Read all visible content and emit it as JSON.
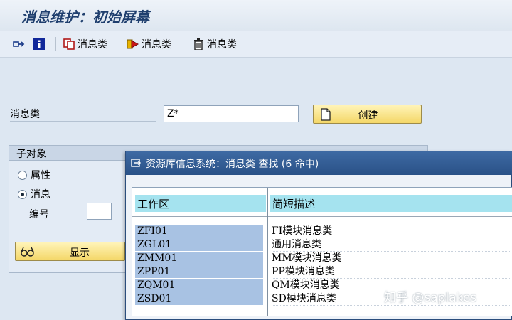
{
  "window": {
    "title": "消息维护：初始屏幕"
  },
  "toolbar": {
    "btn1_label": "消息类",
    "btn2_label": "消息类",
    "btn3_label": "消息类"
  },
  "form": {
    "message_class_label": "消息类",
    "message_class_value": "Z*",
    "create_label": "创建"
  },
  "subobject": {
    "title": "子对象",
    "attr_label": "属性",
    "msg_label": "消息",
    "number_label": "编号",
    "number_value": "",
    "selected": "消息",
    "show_label": "显示"
  },
  "popup": {
    "title": "资源库信息系统：消息类 查找 (6 命中)",
    "columns": [
      "工作区",
      "简短描述"
    ],
    "rows": [
      [
        "ZFI01",
        "FI模块消息类"
      ],
      [
        "ZGL01",
        "通用消息类"
      ],
      [
        "ZMM01",
        "MM模块消息类"
      ],
      [
        "ZPP01",
        "PP模块消息类"
      ],
      [
        "ZQM01",
        "QM模块消息类"
      ],
      [
        "ZSD01",
        "SD模块消息类"
      ]
    ]
  },
  "watermark": "知乎 @saplakes",
  "colors": {
    "title": "#1f3f6e",
    "popup_title_bar": "#2a5187",
    "column_header": "#a5e3ef",
    "key_cell": "#a8c2e3",
    "button_yellow": "#f4d768"
  }
}
